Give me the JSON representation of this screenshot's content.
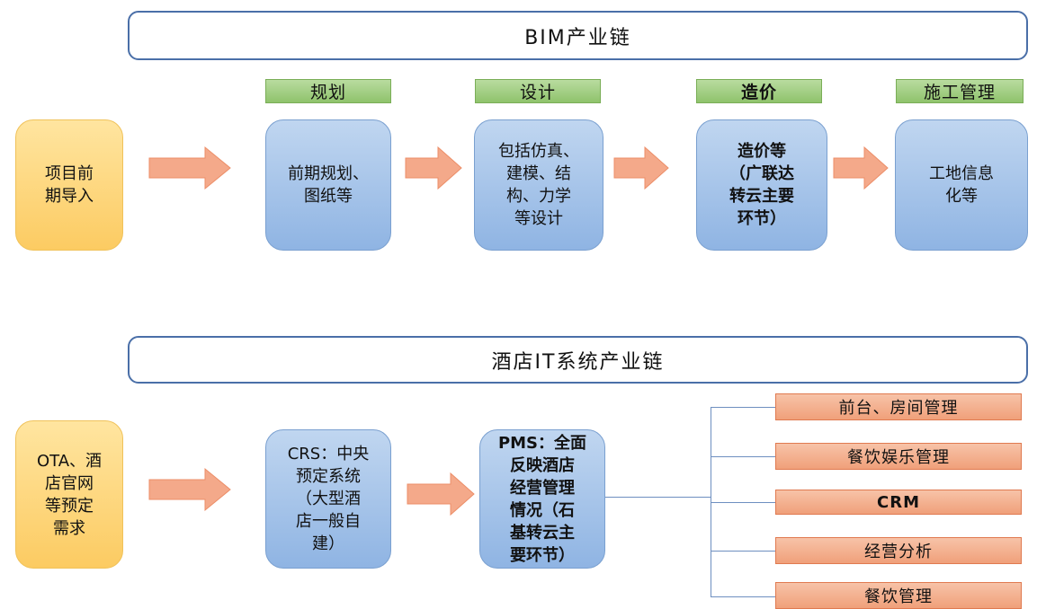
{
  "bim": {
    "title": "BIM产业链",
    "phases": [
      "规划",
      "设计",
      "造价",
      "施工管理"
    ],
    "boxes": {
      "start": "项目前\n期导入",
      "plan": "前期规划、\n图纸等",
      "design": "包括仿真、\n建模、结\n构、力学\n等设计",
      "cost": "造价等\n（广联达\n转云主要\n环节）",
      "construction": "工地信息\n化等"
    }
  },
  "hotel": {
    "title": "酒店IT系统产业链",
    "boxes": {
      "start": "OTA、酒\n店官网\n等预定\n需求",
      "crs": "CRS：中央\n预定系统\n（大型酒\n店一般自\n建）",
      "pms": "PMS：全面\n反映酒店\n经营管理\n情况（石\n基转云主\n要环节）"
    },
    "modules": [
      "前台、房间管理",
      "餐饮娱乐管理",
      "CRM",
      "经营分析",
      "餐饮管理"
    ]
  },
  "colors": {
    "banner_border": "#4a6fa8",
    "phase_fill": "#9bc97a",
    "box_blue": "#a5c3e8",
    "box_yellow": "#fdd57a",
    "arrow": "#f4a98a",
    "module_fill": "#f3b08f"
  }
}
